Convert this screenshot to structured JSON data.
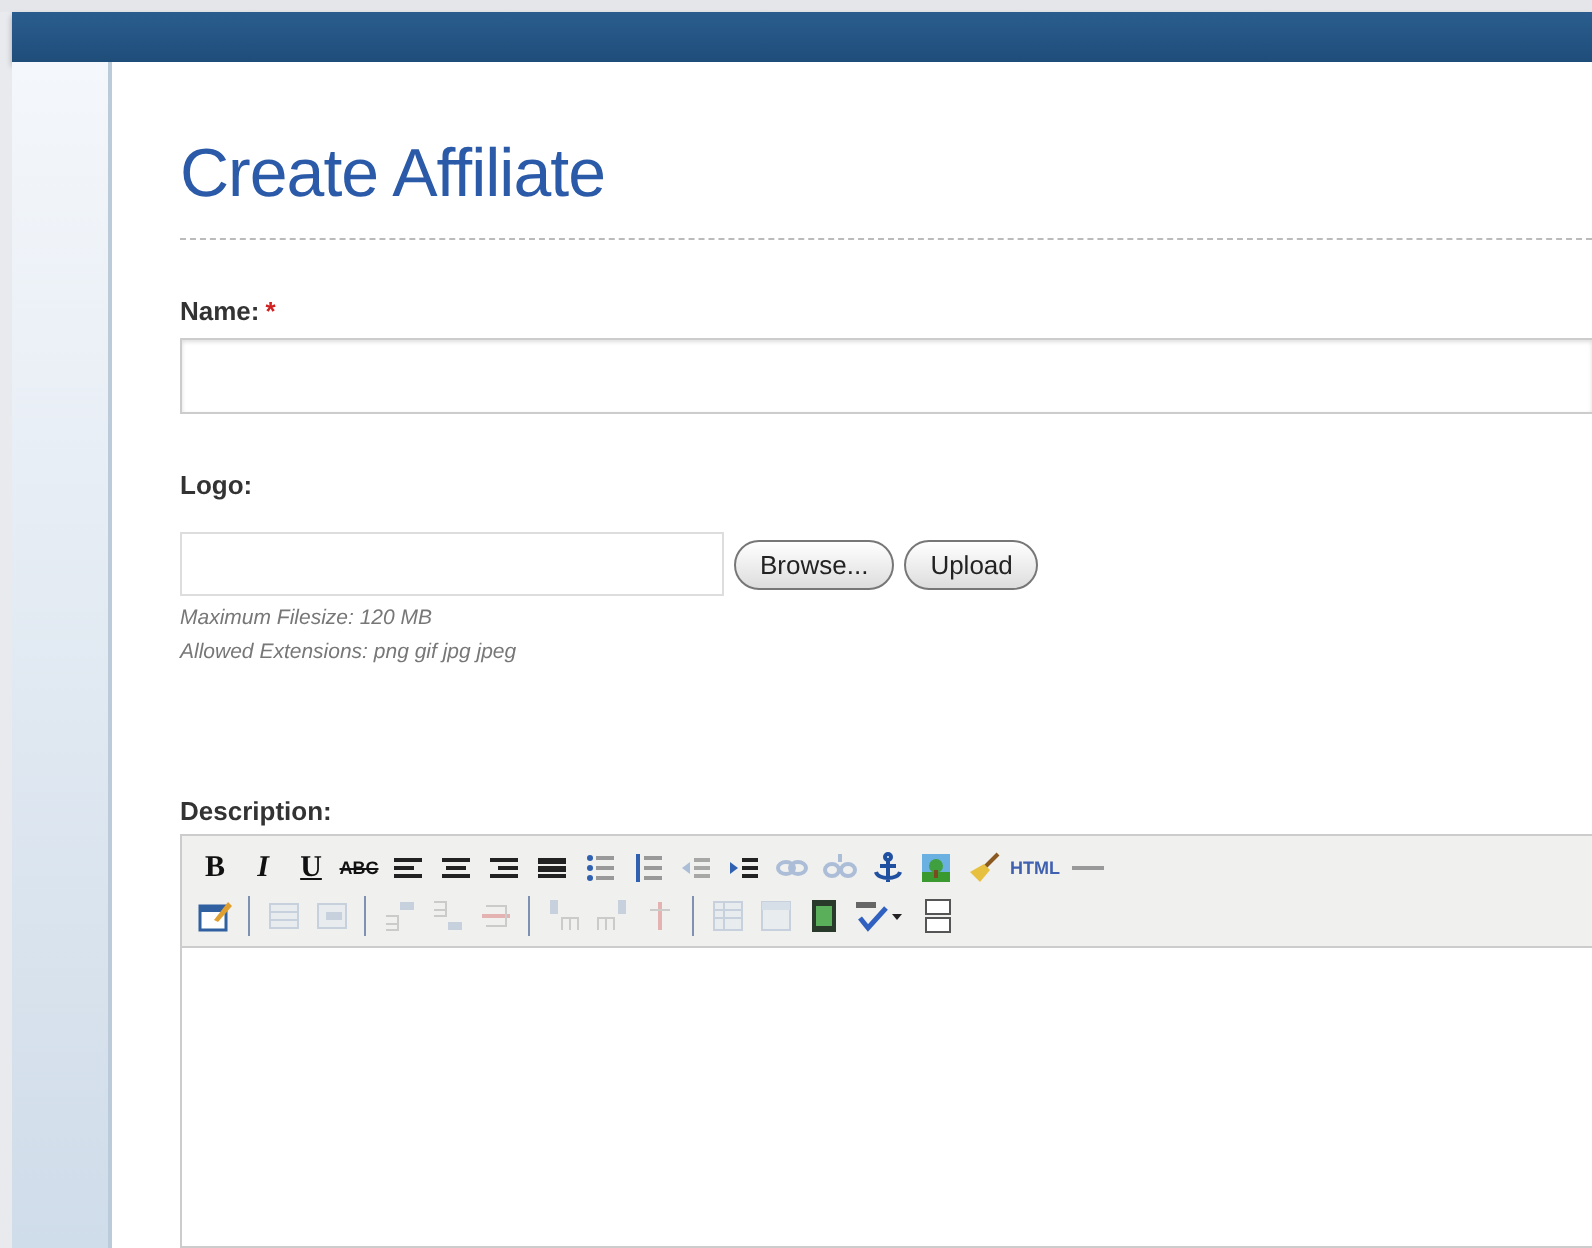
{
  "page": {
    "title": "Create Affiliate"
  },
  "name_field": {
    "label": "Name:",
    "required_mark": "*"
  },
  "logo_field": {
    "label": "Logo:",
    "buttons": [
      "Browse...",
      "Upload"
    ],
    "hints": [
      "Maximum Filesize: 120 MB",
      "Allowed Extensions: png gif jpg jpeg"
    ]
  },
  "description_field": {
    "label": "Description:",
    "toolbar_rows": [
      [
        {
          "label": "B",
          "disabled": false
        },
        {
          "label": "I",
          "disabled": false
        },
        {
          "label": "U",
          "disabled": false
        },
        {
          "label": "ABC",
          "disabled": false
        },
        {
          "disabled": false
        },
        {
          "disabled": false
        },
        {
          "disabled": false
        },
        {
          "disabled": false
        },
        {
          "disabled": false
        },
        {
          "disabled": false
        },
        {
          "disabled": true
        },
        {
          "disabled": false
        },
        {
          "disabled": true
        },
        {
          "disabled": true
        },
        {
          "disabled": false
        },
        {
          "disabled": false
        },
        {
          "disabled": false
        },
        {
          "label": "HTML",
          "disabled": false
        },
        {
          "disabled": false
        }
      ],
      [
        {
          "disabled": false
        },
        {
          "disabled": true
        },
        {
          "disabled": true
        },
        {
          "disabled": true
        },
        {
          "disabled": true
        },
        {
          "disabled": true
        },
        {
          "disabled": true
        },
        {
          "disabled": true
        },
        {
          "disabled": true
        },
        {
          "disabled": true
        },
        {
          "disabled": true
        },
        {
          "disabled": false
        },
        {
          "disabled": false
        },
        {
          "disabled": false
        }
      ]
    ]
  }
}
